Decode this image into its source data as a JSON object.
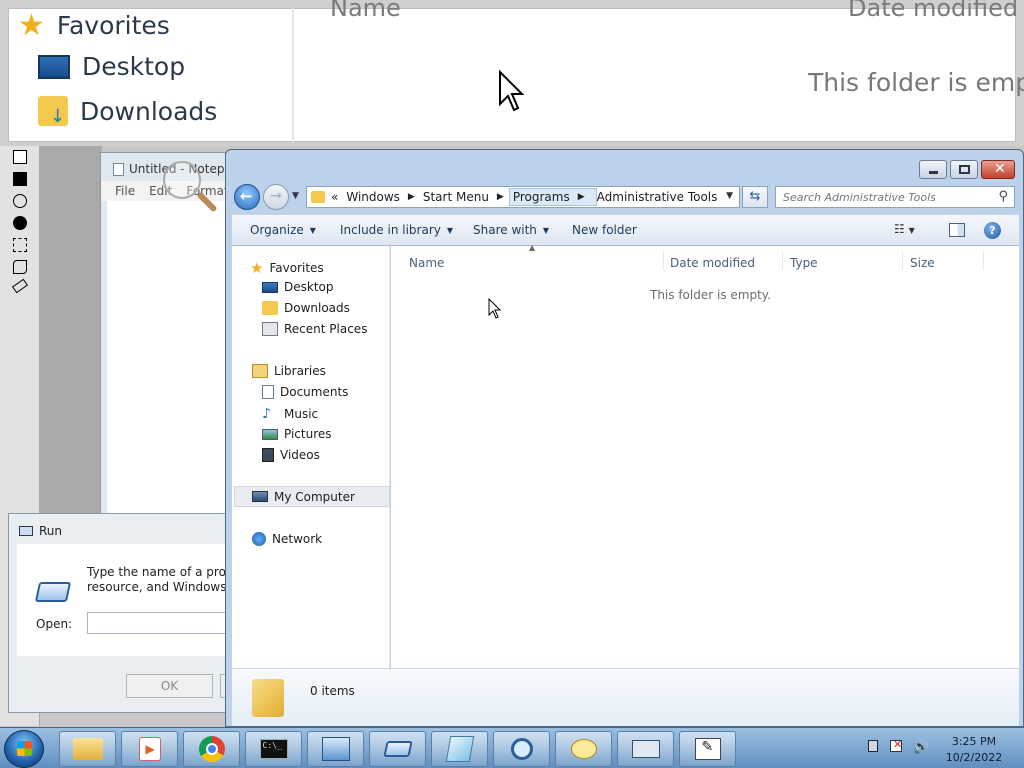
{
  "magnifier": {
    "favorites": "Favorites",
    "desktop": "Desktop",
    "downloads": "Downloads",
    "col_name": "Name",
    "col_date": "Date modified",
    "empty": "This folder is empty"
  },
  "notepad": {
    "title": "Untitled - Notepad",
    "menu": [
      "File",
      "Edit",
      "Format"
    ]
  },
  "run": {
    "title": "Run",
    "description_line1": "Type the name of a program,",
    "description_line2": "resource, and Windows will",
    "open_label": "Open:",
    "ok_label": "OK"
  },
  "explorer": {
    "address": {
      "overflow": "«",
      "crumbs": [
        "Windows",
        "Start Menu",
        "Programs",
        "Administrative Tools"
      ]
    },
    "search_placeholder": "Search Administrative Tools",
    "commands": {
      "organize": "Organize",
      "include": "Include in library",
      "share": "Share with",
      "new_folder": "New folder"
    },
    "nav": {
      "favorites": "Favorites",
      "desktop": "Desktop",
      "downloads": "Downloads",
      "recent": "Recent Places",
      "libraries": "Libraries",
      "documents": "Documents",
      "music": "Music",
      "pictures": "Pictures",
      "videos": "Videos",
      "computer": "My Computer",
      "network": "Network"
    },
    "columns": [
      "Name",
      "Date modified",
      "Type",
      "Size"
    ],
    "empty_text": "This folder is empty.",
    "item_count": "0 items"
  },
  "taskbar": {
    "time": "3:25 PM",
    "date": "10/2/2022"
  },
  "colors": {
    "accent": "#1e395b",
    "taskbar": "#6f9bc8",
    "folder": "#f2c94c"
  }
}
